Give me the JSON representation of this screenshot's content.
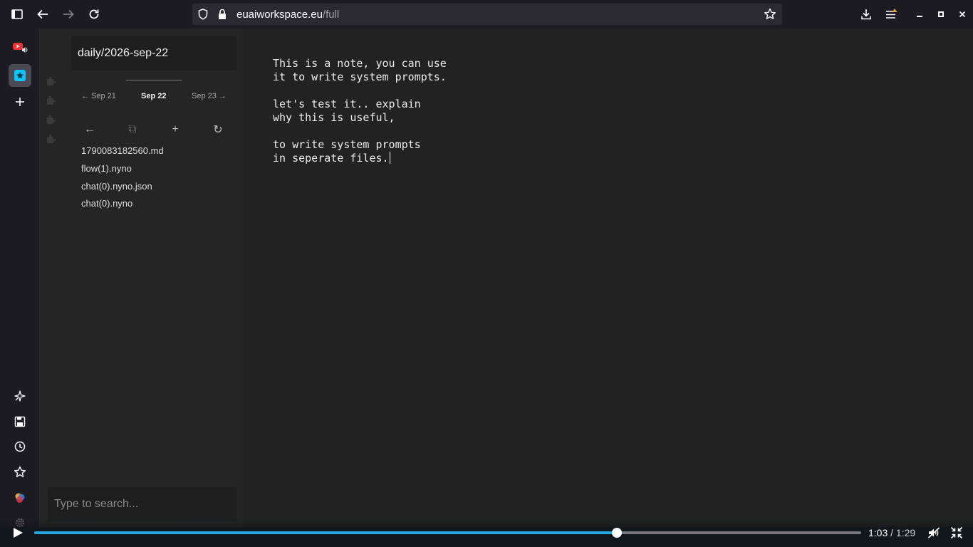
{
  "browser": {
    "url_host": "euaiworkspace.eu",
    "url_path": "/full"
  },
  "sidebar": {
    "note_path": "daily/2026-sep-22",
    "date_nav": {
      "prev": "← Sep 21",
      "current": "Sep 22",
      "next": "Sep 23 →"
    },
    "actions": {
      "back": "←",
      "copy": "⧉",
      "add": "+",
      "refresh": "↻"
    },
    "files": [
      "1790083182560.md",
      "flow(1).nyno",
      "chat(0).nyno.json",
      "chat(0).nyno"
    ],
    "search_placeholder": "Type to search..."
  },
  "editor": {
    "content": "This is a note, you can use\nit to write system prompts.\n\nlet's test it.. explain\nwhy this is useful,\n\nto write system prompts\nin seperate files."
  },
  "video": {
    "current_time": "1:03",
    "separator": " / ",
    "total_time": "1:29",
    "progress": 0.7045
  },
  "colors": {
    "accent": "#22a7e0",
    "app_tile": "#00c8ff"
  },
  "icons": {
    "sidebar_toggle": "sidebar-toggle-icon",
    "back": "back-arrow-icon",
    "forward": "forward-arrow-icon",
    "reload": "reload-icon",
    "shield": "shield-icon",
    "lock": "lock-icon",
    "star": "bookmark-star-icon",
    "download": "download-icon",
    "menu": "menu-icon"
  }
}
